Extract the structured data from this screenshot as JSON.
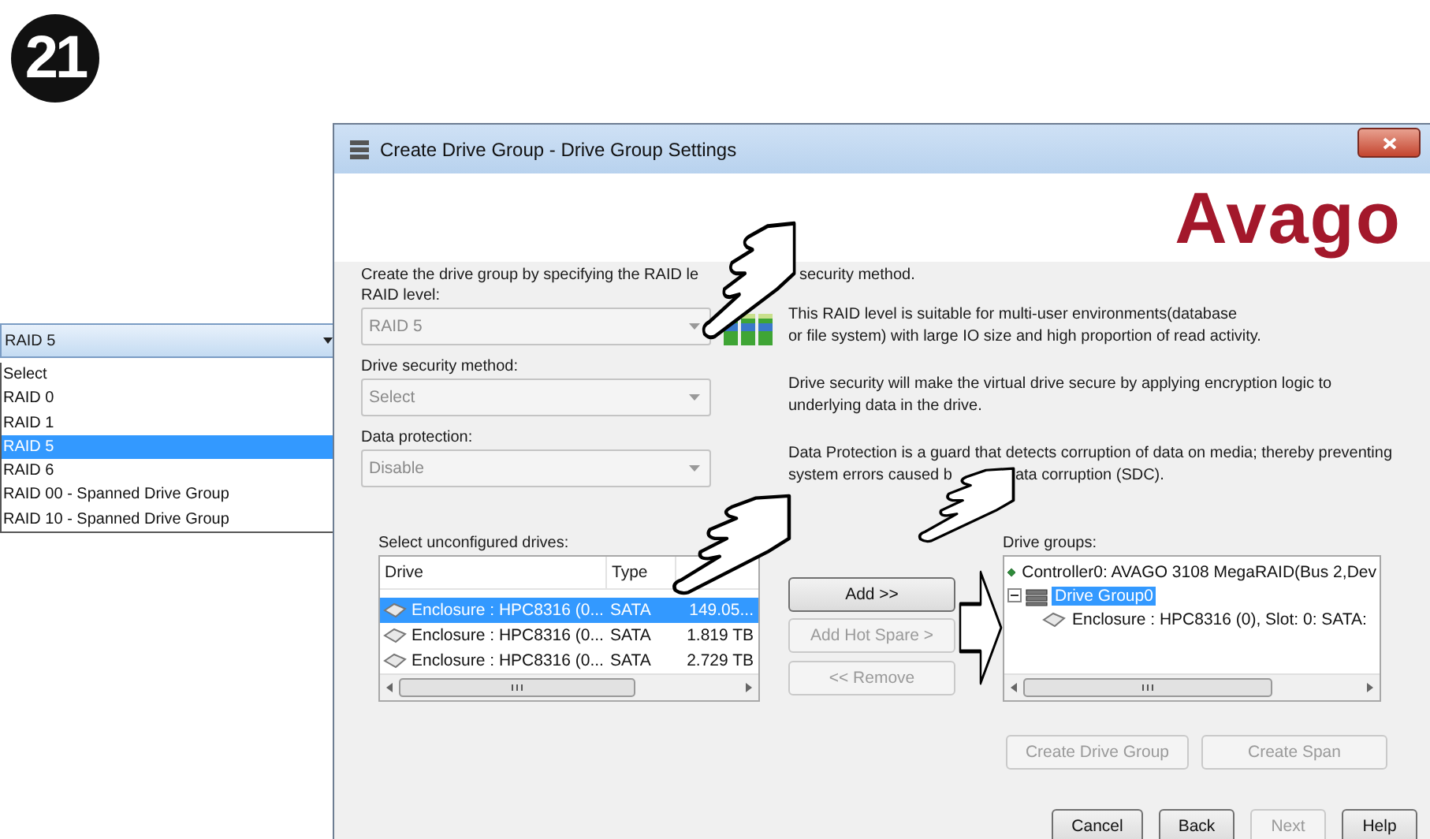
{
  "step_badge": "21",
  "raid_dropdown": {
    "value": "RAID 5",
    "options": [
      {
        "label": "Select",
        "selected": false
      },
      {
        "label": "RAID 0",
        "selected": false
      },
      {
        "label": "RAID 1",
        "selected": false
      },
      {
        "label": "RAID 5",
        "selected": true
      },
      {
        "label": "RAID 6",
        "selected": false
      },
      {
        "label": "RAID 00 - Spanned Drive Group",
        "selected": false
      },
      {
        "label": "RAID 10 - Spanned Drive Group",
        "selected": false
      }
    ]
  },
  "window": {
    "title": "Create Drive Group - Drive Group Settings",
    "logo": "Avago"
  },
  "intro": [
    "Create the drive group by specifying the RAID le",
    "security method."
  ],
  "form": [
    {
      "label": "RAID level:",
      "value": "RAID 5",
      "disabled": true
    },
    {
      "label": "Drive security method:",
      "value": "Select",
      "disabled": true
    },
    {
      "label": "Data protection:",
      "value": "Disable",
      "disabled": true
    }
  ],
  "descriptions": [
    {
      "lines": [
        "This RAID level is suitable for multi-user environments(database",
        "or file system) with large IO size and high proportion of read activity."
      ]
    },
    {
      "lines": [
        "Drive security will make the virtual drive secure by applying encryption logic to",
        "underlying data in the drive."
      ]
    },
    {
      "lines": [
        "Data Protection is a guard that detects corruption of data on media; thereby preventing"
      ],
      "gapped_line": [
        "system errors caused b",
        "ata corruption (SDC)."
      ]
    }
  ],
  "unconfigured_drives": {
    "label": "Select unconfigured drives:",
    "columns": [
      "Drive",
      "Type"
    ],
    "rows": [
      {
        "drive": "Enclosure : HPC8316 (0...",
        "type": "SATA",
        "column_3": "149.05...",
        "selected": true
      },
      {
        "drive": "Enclosure : HPC8316 (0...",
        "type": "SATA",
        "column_3": "1.819 TB",
        "selected": false
      },
      {
        "drive": "Enclosure : HPC8316 (0...",
        "type": "SATA",
        "column_3": "2.729 TB",
        "selected": false
      }
    ]
  },
  "move_buttons": [
    {
      "label": "Add >>",
      "disabled": false
    },
    {
      "label": "Add Hot Spare >",
      "disabled": true
    },
    {
      "label": "<< Remove",
      "disabled": true
    }
  ],
  "drive_groups": {
    "label": "Drive groups:",
    "tree": [
      {
        "label": "Controller0: AVAGO 3108 MegaRAID(Bus 2,Dev",
        "kind": "controller",
        "selected": false
      },
      {
        "label": "Drive Group0",
        "kind": "group",
        "selected": true,
        "expanded": true,
        "children": [
          {
            "label": "Enclosure : HPC8316 (0), Slot: 0: SATA:",
            "kind": "drive",
            "selected": false
          }
        ]
      }
    ]
  },
  "group_buttons": [
    {
      "label": "Create Drive Group",
      "disabled": true
    },
    {
      "label": "Create Span",
      "disabled": true
    }
  ],
  "footer_buttons": [
    {
      "label": "Cancel",
      "disabled": false
    },
    {
      "label": "Back",
      "disabled": false
    },
    {
      "label": "Next",
      "disabled": true
    },
    {
      "label": "Help",
      "disabled": false
    }
  ]
}
